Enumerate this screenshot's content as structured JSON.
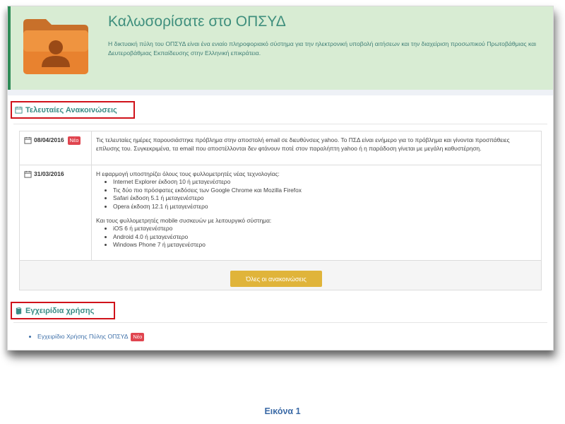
{
  "hero": {
    "title": "Καλωσορίσατε στο ΟΠΣΥΔ",
    "text": "Η δικτυακή πύλη του ΟΠΣΥΔ είναι ένα ενιαίο πληροφοριακό σύστημα για την ηλεκτρονική υποβολή αιτήσεων και την διαχείριση προσωπικού Πρωτοβάθμιας και Δευτεροβάθμιας Εκπαίδευσης στην Ελληνική επικράτεια."
  },
  "announcements": {
    "heading": "Τελευταίες Ανακοινώσεις",
    "items": [
      {
        "date": "08/04/2016",
        "badge": "Νέο",
        "text": "Τις τελευταίες ημέρες παρουσιάστηκε πρόβλημα στην αποστολή email σε διευθύνσεις yahoo. Το ΠΣΔ είναι ενήμερο για το πρόβλημα και γίνονται προσπάθειες επίλυσης του. Συγκεκριμένα, τα email που αποστέλλονται δεν φτάνουν ποτέ στον παραλήπτη yahoo ή η παράδοση γίνεται με μεγάλη καθυστέρηση."
      },
      {
        "date": "31/03/2016",
        "intro": "Η εφαρμογή υποστηρίζει όλους τους φυλλομετρητές νέας τεχνολογίας:",
        "browsers": [
          "Internet Explorer έκδοση 10 ή μεταγενέστερο",
          "Τις δύο πιο πρόσφατες εκδόσεις των Google Chrome και Mozilla Firefox",
          "Safari έκδοση 5.1 ή μεταγενέστερο",
          "Opera έκδοση 12.1 ή μεταγενέστερο"
        ],
        "mobile_intro": "Και τους φυλλομετρητές mobile συσκευών με λειτουργικό σύστημα:",
        "mobile": [
          "iOS 6 ή μεταγενέστερο",
          "Android 4.0 ή μεταγενέστερο",
          "Windows Phone 7 ή μεταγενέστερο"
        ]
      }
    ],
    "all_button": "Όλες οι ανακοινώσεις"
  },
  "manuals": {
    "heading": "Εγχειρίδια χρήσης",
    "items": [
      {
        "label": "Εγχειρίδιο Χρήσης Πύλης ΟΠΣΥΔ",
        "badge": "Νέο"
      }
    ]
  },
  "caption": "Εικόνα 1",
  "colors": {
    "hero_bg": "#d8ecd3",
    "accent": "#3a8d86",
    "highlight_border": "#d0121a",
    "badge": "#e0454f",
    "button": "#e0b43a"
  },
  "icons": {
    "folder": "user-folder-icon",
    "calendar": "calendar-icon",
    "book": "book-icon"
  }
}
